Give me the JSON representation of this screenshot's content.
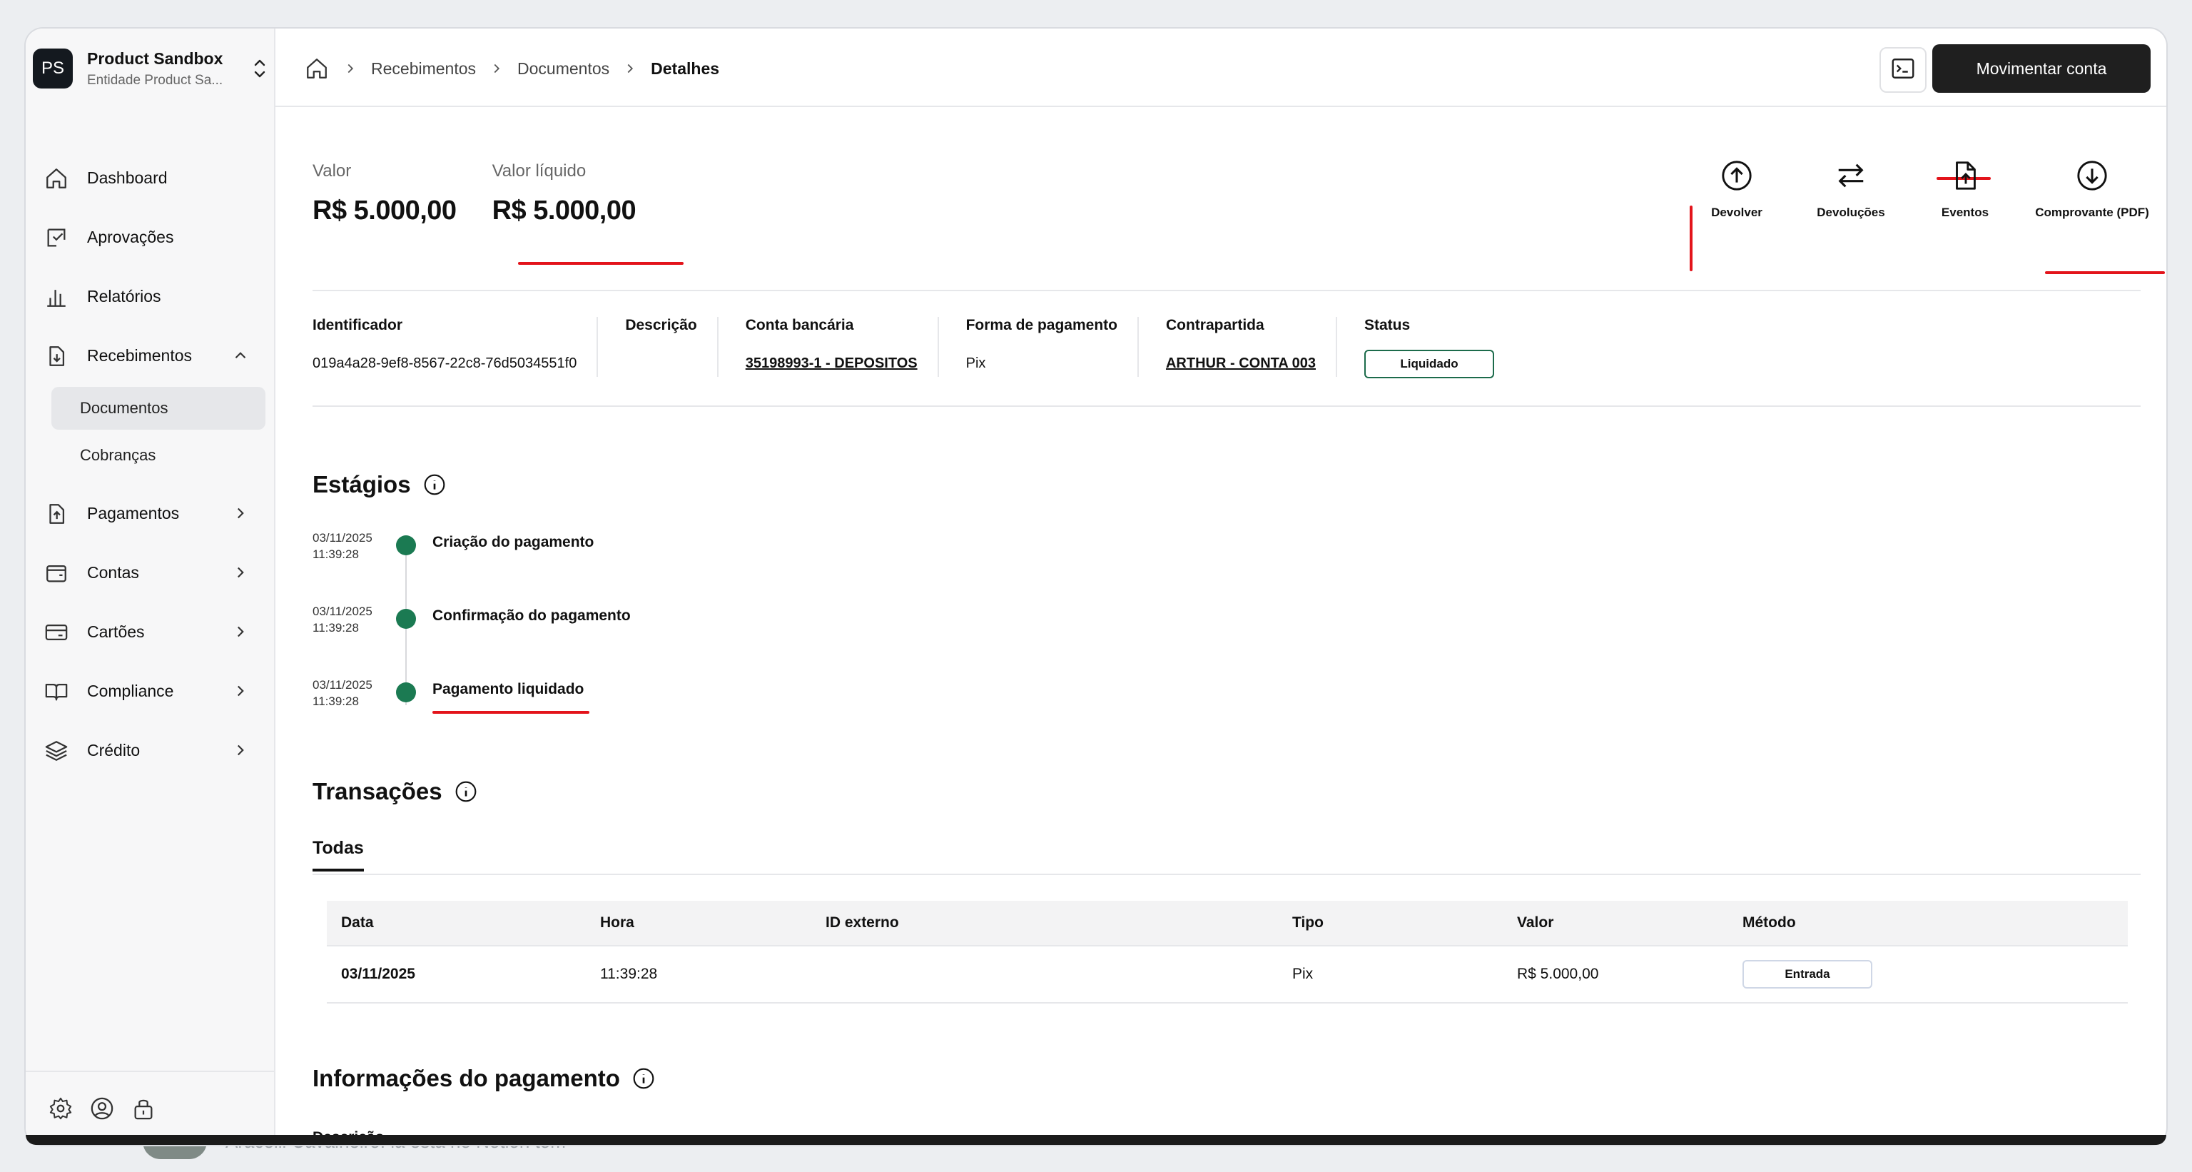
{
  "org": {
    "initials": "PS",
    "name": "Product Sandbox",
    "subtitle": "Entidade Product Sa..."
  },
  "sidebar": {
    "items": [
      {
        "label": "Dashboard"
      },
      {
        "label": "Aprovações"
      },
      {
        "label": "Relatórios"
      },
      {
        "label": "Recebimentos"
      },
      {
        "label": "Pagamentos"
      },
      {
        "label": "Contas"
      },
      {
        "label": "Cartões"
      },
      {
        "label": "Compliance"
      },
      {
        "label": "Crédito"
      }
    ],
    "sub_items": [
      {
        "label": "Documentos",
        "active": true
      },
      {
        "label": "Cobranças",
        "active": false
      }
    ]
  },
  "breadcrumb": {
    "items": [
      "Recebimentos",
      "Documentos"
    ],
    "current": "Detalhes"
  },
  "header": {
    "move_button": "Movimentar conta"
  },
  "amounts": {
    "valor_label": "Valor",
    "valor": "R$ 5.000,00",
    "liquido_label": "Valor líquido",
    "liquido": "R$ 5.000,00"
  },
  "actions": [
    {
      "label": "Devolver",
      "icon": "arrow-up-circle-icon"
    },
    {
      "label": "Devoluções",
      "icon": "swap-arrows-icon"
    },
    {
      "label": "Eventos",
      "icon": "file-upload-icon"
    },
    {
      "label": "Comprovante (PDF)",
      "icon": "arrow-down-circle-icon"
    }
  ],
  "info": {
    "identificador_label": "Identificador",
    "identificador": "019a4a28-9ef8-8567-22c8-76d5034551f0",
    "descricao_label": "Descrição",
    "conta_label": "Conta bancária",
    "conta": "35198993-1 - DEPOSITOS",
    "forma_label": "Forma de pagamento",
    "forma": "Pix",
    "contrapartida_label": "Contrapartida",
    "contrapartida": "ARTHUR - CONTA 003",
    "status_label": "Status",
    "status": "Liquidado"
  },
  "stages": {
    "title": "Estágios",
    "items": [
      {
        "date": "03/11/2025",
        "time": "11:39:28",
        "label": "Criação do pagamento"
      },
      {
        "date": "03/11/2025",
        "time": "11:39:28",
        "label": "Confirmação do pagamento"
      },
      {
        "date": "03/11/2025",
        "time": "11:39:28",
        "label": "Pagamento liquidado"
      }
    ]
  },
  "transactions": {
    "title": "Transações",
    "tab": "Todas",
    "columns": [
      "Data",
      "Hora",
      "ID externo",
      "Tipo",
      "Valor",
      "Método"
    ],
    "rows": [
      {
        "data": "03/11/2025",
        "hora": "11:39:28",
        "id_externo": "",
        "tipo": "Pix",
        "valor": "R$ 5.000,00",
        "metodo": "Entrada"
      }
    ]
  },
  "payment_info": {
    "title": "Informações do pagamento",
    "descricao_label": "Descrição"
  },
  "background_notification": {
    "text": "Aracelli Cavalheiro: lá está no Notion tom"
  },
  "colors": {
    "accent_dark": "#1f1f1f",
    "status_green": "#1b7a52",
    "annotation_red": "#e3141b"
  }
}
